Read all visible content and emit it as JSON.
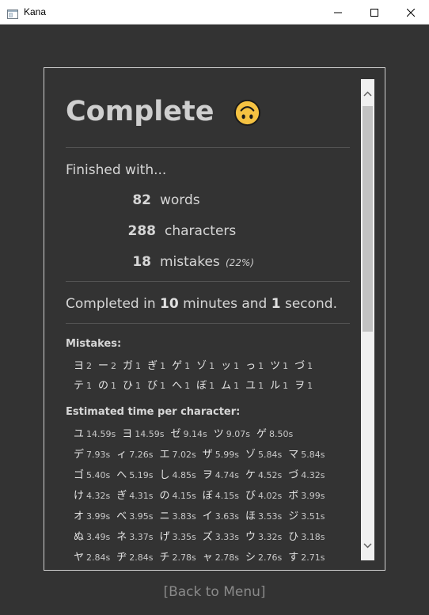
{
  "window": {
    "title": "Kana"
  },
  "summary": {
    "heading": "Complete",
    "emoji_icon": "upside-down-face-emoji",
    "finished_label": "Finished with...",
    "words": {
      "value": "82",
      "label": "words"
    },
    "characters": {
      "value": "288",
      "label": "characters"
    },
    "mistakes": {
      "value": "18",
      "label": "mistakes",
      "percent": "(22%)"
    },
    "completed": {
      "prefix": "Completed in",
      "minutes": "10",
      "minutes_label": "minutes and",
      "seconds": "1",
      "seconds_label": "second."
    }
  },
  "mistakes_section": {
    "title": "Mistakes:",
    "rows": [
      [
        {
          "char": "ヨ",
          "count": "2"
        },
        {
          "char": "ー",
          "count": "2"
        },
        {
          "char": "ガ",
          "count": "1"
        },
        {
          "char": "ぎ",
          "count": "1"
        },
        {
          "char": "ゲ",
          "count": "1"
        },
        {
          "char": "ゾ",
          "count": "1"
        },
        {
          "char": "ッ",
          "count": "1"
        },
        {
          "char": "っ",
          "count": "1"
        },
        {
          "char": "ツ",
          "count": "1"
        },
        {
          "char": "づ",
          "count": "1"
        }
      ],
      [
        {
          "char": "テ",
          "count": "1"
        },
        {
          "char": "の",
          "count": "1"
        },
        {
          "char": "ひ",
          "count": "1"
        },
        {
          "char": "び",
          "count": "1"
        },
        {
          "char": "へ",
          "count": "1"
        },
        {
          "char": "ぼ",
          "count": "1"
        },
        {
          "char": "ム",
          "count": "1"
        },
        {
          "char": "ユ",
          "count": "1"
        },
        {
          "char": "ル",
          "count": "1"
        },
        {
          "char": "ヲ",
          "count": "1"
        }
      ]
    ]
  },
  "time_section": {
    "title": "Estimated time per character:",
    "rows": [
      [
        {
          "char": "ユ",
          "time": "14.59s"
        },
        {
          "char": "ヨ",
          "time": "14.59s"
        },
        {
          "char": "ゼ",
          "time": "9.14s"
        },
        {
          "char": "ツ",
          "time": "9.07s"
        },
        {
          "char": "ゲ",
          "time": "8.50s"
        }
      ],
      [
        {
          "char": "デ",
          "time": "7.93s"
        },
        {
          "char": "ィ",
          "time": "7.26s"
        },
        {
          "char": "エ",
          "time": "7.02s"
        },
        {
          "char": "ザ",
          "time": "5.99s"
        },
        {
          "char": "ゾ",
          "time": "5.84s"
        },
        {
          "char": "マ",
          "time": "5.84s"
        }
      ],
      [
        {
          "char": "ゴ",
          "time": "5.40s"
        },
        {
          "char": "へ",
          "time": "5.19s"
        },
        {
          "char": "し",
          "time": "4.85s"
        },
        {
          "char": "ヲ",
          "time": "4.74s"
        },
        {
          "char": "ケ",
          "time": "4.52s"
        },
        {
          "char": "づ",
          "time": "4.32s"
        }
      ],
      [
        {
          "char": "け",
          "time": "4.32s"
        },
        {
          "char": "ぎ",
          "time": "4.31s"
        },
        {
          "char": "の",
          "time": "4.15s"
        },
        {
          "char": "ぼ",
          "time": "4.15s"
        },
        {
          "char": "び",
          "time": "4.02s"
        },
        {
          "char": "ボ",
          "time": "3.99s"
        }
      ],
      [
        {
          "char": "オ",
          "time": "3.99s"
        },
        {
          "char": "べ",
          "time": "3.95s"
        },
        {
          "char": "ニ",
          "time": "3.83s"
        },
        {
          "char": "イ",
          "time": "3.63s"
        },
        {
          "char": "ほ",
          "time": "3.53s"
        },
        {
          "char": "ジ",
          "time": "3.51s"
        }
      ],
      [
        {
          "char": "ぬ",
          "time": "3.49s"
        },
        {
          "char": "ネ",
          "time": "3.37s"
        },
        {
          "char": "げ",
          "time": "3.35s"
        },
        {
          "char": "ズ",
          "time": "3.33s"
        },
        {
          "char": "ウ",
          "time": "3.32s"
        },
        {
          "char": "ひ",
          "time": "3.18s"
        }
      ],
      [
        {
          "char": "ヤ",
          "time": "2.84s"
        },
        {
          "char": "ヂ",
          "time": "2.84s"
        },
        {
          "char": "チ",
          "time": "2.78s"
        },
        {
          "char": "ャ",
          "time": "2.78s"
        },
        {
          "char": "シ",
          "time": "2.76s"
        },
        {
          "char": "す",
          "time": "2.71s"
        }
      ]
    ]
  },
  "navigation": {
    "back_label": "[Back to Menu]"
  },
  "colors": {
    "background": "#333333",
    "text": "#d6d6d6",
    "link": "#8a8a8a",
    "emoji": "#f5c242"
  }
}
